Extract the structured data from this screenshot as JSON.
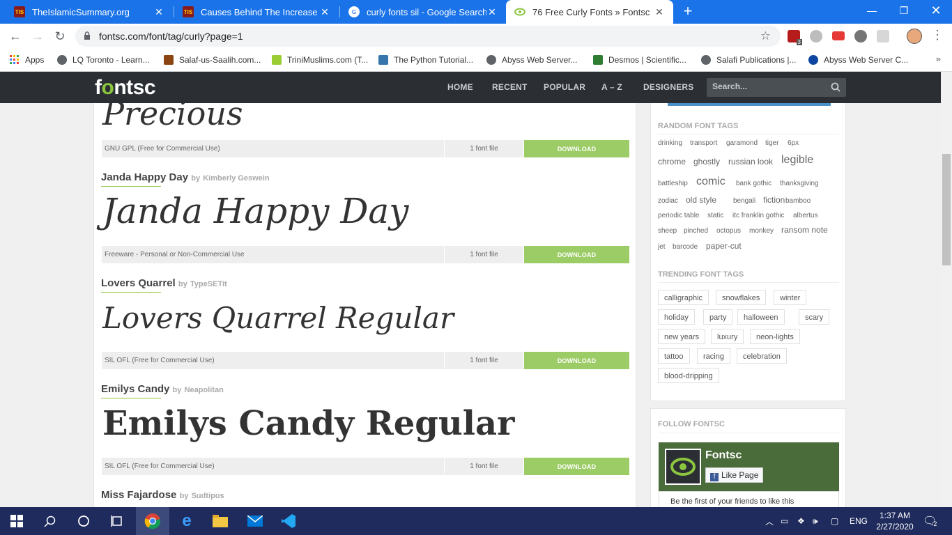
{
  "browser": {
    "tabs": [
      {
        "title": "TheIslamicSummary.org",
        "favicon": "TIS",
        "active": false
      },
      {
        "title": "Causes Behind The Increase And",
        "favicon": "TIS",
        "active": false
      },
      {
        "title": "curly fonts sil - Google Search",
        "favicon": "G",
        "active": false
      },
      {
        "title": "76 Free Curly Fonts » Fontsc",
        "favicon": "eye",
        "active": true
      }
    ],
    "url": "fontsc.com/font/tag/curly?page=1",
    "extension_badge": "3",
    "bookmarks": [
      {
        "label": "Apps",
        "color": "#ea4335"
      },
      {
        "label": "LQ Toronto - Learn...",
        "color": "#5f6368"
      },
      {
        "label": "Salaf-us-Saalih.com...",
        "color": "#8b4513"
      },
      {
        "label": "TriniMuslims.com (T...",
        "color": "#9acd32"
      },
      {
        "label": "The Python Tutorial...",
        "color": "#3776ab"
      },
      {
        "label": "Abyss Web Server...",
        "color": "#5f6368"
      },
      {
        "label": "Desmos | Scientific...",
        "color": "#2e7d32"
      },
      {
        "label": "Salafi Publications |...",
        "color": "#5f6368"
      },
      {
        "label": "Abyss Web Server C...",
        "color": "#0d47a1"
      }
    ]
  },
  "site": {
    "logo_pre": "f",
    "logo_o": "o",
    "logo_post": "ntsc",
    "nav": [
      "HOME",
      "RECENT",
      "POPULAR",
      "A – Z",
      "DESIGNERS"
    ],
    "search_placeholder": "Search..."
  },
  "fonts": [
    {
      "preview": "Precious",
      "license": "GNU GPL (Free for Commercial Use)",
      "files": "1 font file",
      "download": "DOWNLOAD"
    },
    {
      "name": "Janda Happy Day",
      "by": "by",
      "author": "Kimberly Geswein",
      "preview": "Janda Happy Day",
      "license": "Freeware - Personal or Non-Commercial Use",
      "files": "1 font file",
      "download": "DOWNLOAD"
    },
    {
      "name": "Lovers Quarrel",
      "by": "by",
      "author": "TypeSETit",
      "preview": "Lovers Quarrel Regular",
      "license": "SIL OFL (Free for Commercial Use)",
      "files": "1 font file",
      "download": "DOWNLOAD"
    },
    {
      "name": "Emilys Candy",
      "by": "by",
      "author": "Neapolitan",
      "preview": "Emilys Candy Regular",
      "license": "SIL OFL (Free for Commercial Use)",
      "files": "1 font file",
      "download": "DOWNLOAD"
    },
    {
      "name": "Miss Fajardose",
      "by": "by",
      "author": "Sudtipos"
    }
  ],
  "sidebar": {
    "random_heading": "RANDOM FONT TAGS",
    "random_tags": [
      "drinking",
      "transport",
      "garamond",
      "tiger",
      "6px",
      "chrome",
      "ghostly",
      "russian look",
      "legible",
      "battleship",
      "comic",
      "bank gothic",
      "thanksgiving",
      "zodiac",
      "old style",
      "bengali",
      "fiction",
      "bamboo",
      "periodic table",
      "static",
      "itc franklin gothic",
      "albertus",
      "sheep",
      "pinched",
      "octopus",
      "monkey",
      "ransom note",
      "jet",
      "barcode",
      "paper-cut"
    ],
    "trending_heading": "TRENDING FONT TAGS",
    "trending_tags": [
      "calligraphic",
      "snowflakes",
      "winter",
      "holiday",
      "party",
      "halloween",
      "scary",
      "new years",
      "luxury",
      "neon-lights",
      "tattoo",
      "racing",
      "celebration",
      "blood-dripping"
    ],
    "follow_heading": "FOLLOW FONTSC",
    "fb_page_name": "Fontsc",
    "fb_like": "Like Page",
    "fb_friends": "Be the first of your friends to like this"
  },
  "taskbar": {
    "time": "1:37 AM",
    "date": "2/27/2020",
    "lang": "ENG",
    "notifications": "2"
  },
  "colors": {
    "tabstrip": "#1a73e8",
    "sitenav": "#2b2f33",
    "accent_green": "#8cc63f",
    "download_green": "#9ccc65",
    "taskbar": "#1e2b5c"
  }
}
